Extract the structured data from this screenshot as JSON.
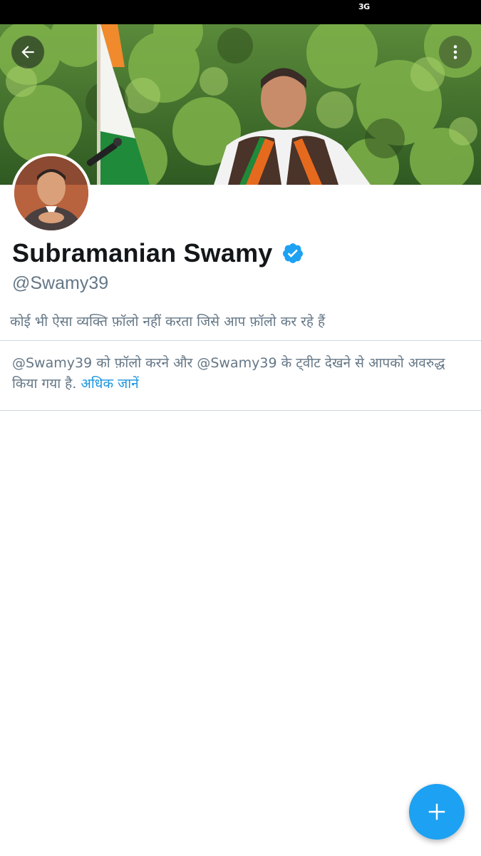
{
  "status_bar": {
    "network": "3G"
  },
  "header": {
    "back_icon": "arrow-left-icon",
    "more_icon": "more-vertical-icon"
  },
  "profile": {
    "name": "Subramanian Swamy",
    "verified": true,
    "handle": "@Swamy39",
    "followers_you_know": "कोई भी ऐसा व्यक्ति फ़ॉलो नहीं करता जिसे आप फ़ॉलो कर रहे हैं"
  },
  "blocked_notice": {
    "text": "@Swamy39 को फ़ॉलो करने और @Swamy39 के ट्वीट देखने से आपको अवरुद्ध किया गया है. ",
    "learn_more": "अधिक जानें"
  },
  "fab": {
    "icon": "plus-icon"
  },
  "colors": {
    "accent": "#1da1f2",
    "link": "#1b95e0",
    "verified": "#1da1f2",
    "secondary_text": "#657786",
    "primary_text": "#14171a",
    "divider": "#cfd8de",
    "status_bar": "#000000"
  }
}
